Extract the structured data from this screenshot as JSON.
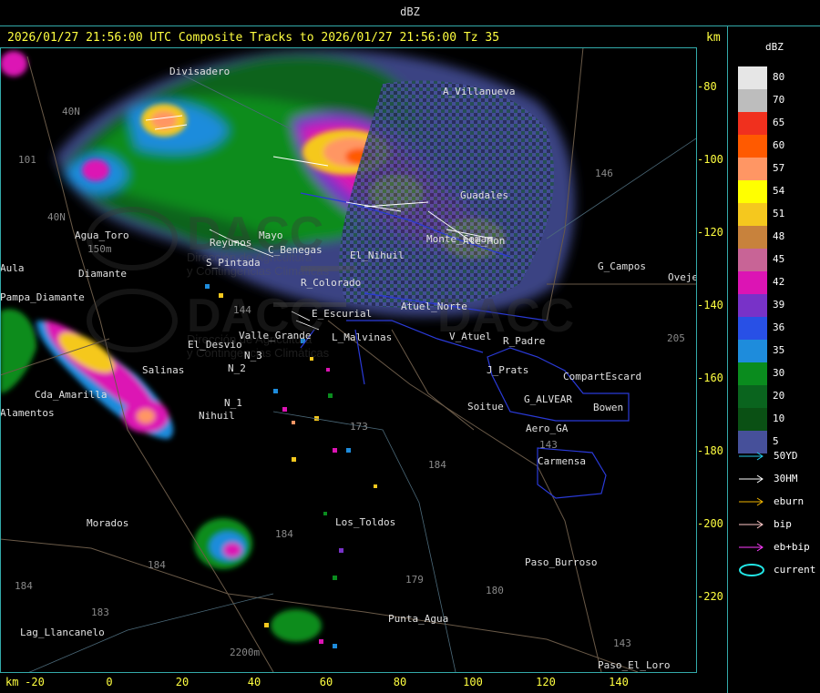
{
  "window_title": "dBZ",
  "headline": "2026/01/27 21:56:00 UTC Composite Tracks to 2026/01/27 21:56:00 Tz 35",
  "unit_label": "km",
  "y_ticks": [
    "-80",
    "-100",
    "-120",
    "-140",
    "-160",
    "-180",
    "-200",
    "-220"
  ],
  "x_ticks": [
    "-20",
    "0",
    "20",
    "40",
    "60",
    "80",
    "100",
    "120",
    "140"
  ],
  "legend": {
    "title": "dBZ",
    "levels": [
      {
        "label": "80",
        "color": "#e6e6e6"
      },
      {
        "label": "70",
        "color": "#bdbdbd"
      },
      {
        "label": "65",
        "color": "#f0301e"
      },
      {
        "label": "60",
        "color": "#ff5a00"
      },
      {
        "label": "57",
        "color": "#ff9664"
      },
      {
        "label": "54",
        "color": "#ffff00"
      },
      {
        "label": "51",
        "color": "#f5c81e"
      },
      {
        "label": "48",
        "color": "#c8823c"
      },
      {
        "label": "45",
        "color": "#c86496"
      },
      {
        "label": "42",
        "color": "#dc14b4"
      },
      {
        "label": "39",
        "color": "#7832c8"
      },
      {
        "label": "36",
        "color": "#2850e6"
      },
      {
        "label": "35",
        "color": "#1e8cdc"
      },
      {
        "label": "30",
        "color": "#0a8c1e"
      },
      {
        "label": "20",
        "color": "#0a641e"
      },
      {
        "label": "10",
        "color": "#0a5014"
      },
      {
        "label": "5",
        "color": "#46509a"
      }
    ],
    "tracks": [
      {
        "label": "50YD",
        "color": "#22c8e6"
      },
      {
        "label": "30HM",
        "color": "#ffffff"
      },
      {
        "label": "eburn",
        "color": "#f0b400"
      },
      {
        "label": "bip",
        "color": "#ffc8c8"
      },
      {
        "label": "eb+bip",
        "color": "#ff3cff"
      },
      {
        "label": "current",
        "color": "#22e6e6"
      }
    ]
  },
  "places": [
    "Divisadero",
    "A_Villanueva",
    "Guadales",
    "Agua_Toro",
    "Reyunos",
    "S_Pintada",
    "C_Benegas",
    "El_Nihuil",
    "Ate_Mon",
    "G_Campos",
    "Ovejer",
    "Pampa_Diamante",
    "E_Escurial",
    "Atuel_Norte",
    "El_Desvio",
    "Valle_Grande",
    "L_Malvinas",
    "V_Atuel",
    "R_Padre",
    "Salinas",
    "Cda_Amarilla",
    "N_2",
    "N_1",
    "Nihuil",
    "J_Prats",
    "CompartEscard",
    "G_ALVEAR",
    "Soitue",
    "Bowen",
    "Aero_GA",
    "Carmensa",
    "Morados",
    "Los_Toldos",
    "Paso_Burroso",
    "Punta_Agua",
    "Lag_Llancanelo",
    "Paso_El_Loro",
    "Monte_Coman",
    "Mayo",
    "R_Colorado",
    "N_3",
    "Alamentos",
    "Diamante",
    "Aula"
  ],
  "roads": [
    "101",
    "40N",
    "40N",
    "146",
    "144",
    "173",
    "184",
    "184",
    "179",
    "180",
    "143",
    "143",
    "184",
    "183",
    "205",
    "184",
    "150m",
    "2200m"
  ],
  "watermark": {
    "logo": "DACC",
    "line1": "Dirección de Agricultura",
    "line2": "y Contingencias Climáticas"
  }
}
